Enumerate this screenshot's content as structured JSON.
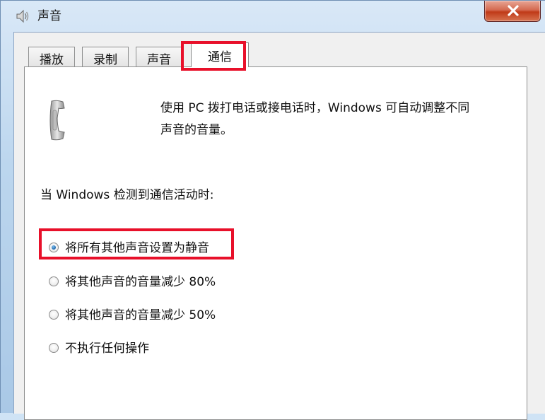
{
  "window": {
    "title": "声音",
    "title_icon": "speaker-icon",
    "close_icon": "close-icon"
  },
  "tabs": [
    {
      "label": "播放",
      "active": false
    },
    {
      "label": "录制",
      "active": false
    },
    {
      "label": "声音",
      "active": false
    },
    {
      "label": "通信",
      "active": true
    }
  ],
  "panel": {
    "icon": "telephone-icon",
    "description_line1": "使用 PC 拨打电话或接电话时，Windows 可自动调整不同",
    "description_line2": "声音的音量。",
    "prompt": "当 Windows 检测到通信活动时:",
    "options": [
      {
        "label": "将所有其他声音设置为静音",
        "checked": true
      },
      {
        "label": "将其他声音的音量减少 80%",
        "checked": false
      },
      {
        "label": "将其他声音的音量减少 50%",
        "checked": false
      },
      {
        "label": "不执行任何操作",
        "checked": false
      }
    ]
  },
  "colors": {
    "highlight": "#e8102a",
    "close_button": "#c03a18"
  }
}
